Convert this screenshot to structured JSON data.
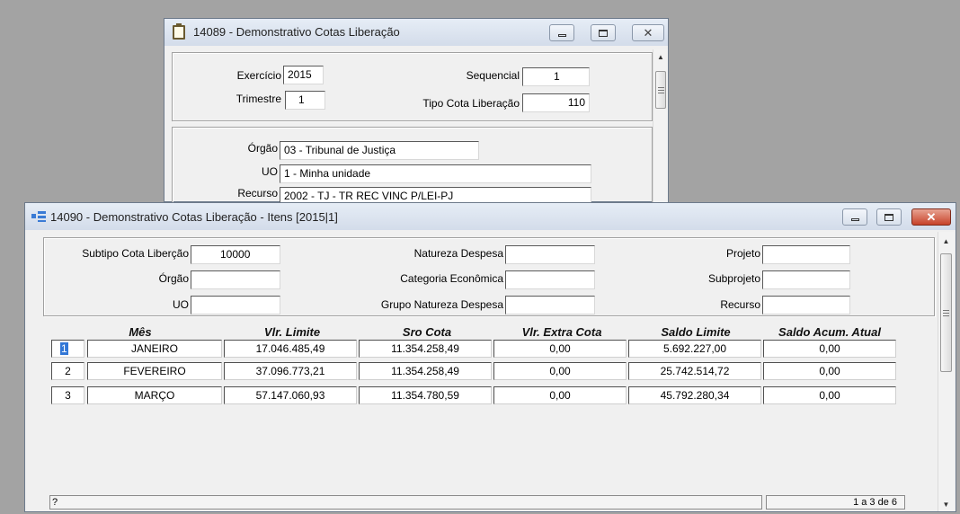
{
  "back_window": {
    "title": "14089 - Demonstrativo Cotas Liberação",
    "exercicio_label": "Exercício",
    "exercicio_value": "2015",
    "trimestre_label": "Trimestre",
    "trimestre_value": "1",
    "sequencial_label": "Sequencial",
    "sequencial_value": "1",
    "tipo_cota_label": "Tipo Cota Liberação",
    "tipo_cota_value": "110",
    "orgao_label": "Órgão",
    "orgao_value": "03 - Tribunal de Justiça",
    "uo_label": "UO",
    "uo_value": "1 -  Minha unidade",
    "recurso_label": "Recurso",
    "recurso_value": "2002 - TJ - TR REC VINC P/LEI-PJ"
  },
  "front_window": {
    "title": "14090 - Demonstrativo Cotas Liberação - Itens [2015|1]",
    "filters": {
      "subtipo_label": "Subtipo Cota Liberção",
      "subtipo_value": "10000",
      "orgao_label": "Órgão",
      "orgao_value": "",
      "uo_label": "UO",
      "uo_value": "",
      "natureza_label": "Natureza Despesa",
      "natureza_value": "",
      "categoria_label": "Categoria Econômica",
      "categoria_value": "",
      "grupo_label": "Grupo Natureza Despesa",
      "grupo_value": "",
      "projeto_label": "Projeto",
      "projeto_value": "",
      "subprojeto_label": "Subprojeto",
      "subprojeto_value": "",
      "recurso_label": "Recurso",
      "recurso_value": ""
    },
    "table": {
      "columns": [
        "Mês",
        "Vlr. Limite",
        "Sro Cota",
        "Vlr. Extra Cota",
        "Saldo Limite",
        "Saldo Acum. Atual"
      ],
      "rows": [
        {
          "num": "1",
          "mes": "JANEIRO",
          "limite": "17.046.485,49",
          "sro": "11.354.258,49",
          "extra": "0,00",
          "saldo": "5.692.227,00",
          "acum": "0,00"
        },
        {
          "num": "2",
          "mes": "FEVEREIRO",
          "limite": "37.096.773,21",
          "sro": "11.354.258,49",
          "extra": "0,00",
          "saldo": "25.742.514,72",
          "acum": "0,00"
        },
        {
          "num": "3",
          "mes": "MARÇO",
          "limite": "57.147.060,93",
          "sro": "11.354.780,59",
          "extra": "0,00",
          "saldo": "45.792.280,34",
          "acum": "0,00"
        }
      ]
    },
    "status": {
      "hint": "?",
      "pagination": "1 a 3 de 6"
    }
  },
  "icons": {
    "back_window_icon": "clipboard-icon",
    "front_window_icon": "grid-items-icon",
    "minimize": "minimize-icon",
    "maximize": "maximize-icon",
    "close": "close-icon"
  },
  "colors": {
    "desktop": "#a3a3a3",
    "close_button": "#c7432a",
    "selection": "#3277d6"
  }
}
